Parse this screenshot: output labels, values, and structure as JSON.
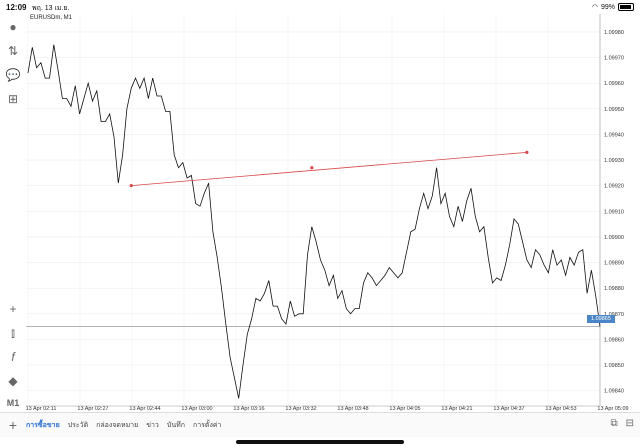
{
  "status": {
    "time": "12:09",
    "date": "พฤ. 13 เม.ย.",
    "battery": "99%"
  },
  "chart": {
    "symbol": "EURUSDm, M1",
    "current_price_label": "1.09865"
  },
  "toolbar": {
    "icons": [
      "account-icon",
      "trade-icon",
      "chat-icon",
      "new-document-icon"
    ],
    "lower_icons": [
      "crosshair-icon",
      "indicators-icon",
      "function-icon",
      "objects-icon"
    ],
    "timeframe": "M1"
  },
  "bottom": {
    "tabs": [
      "การซื้อขาย",
      "ประวัติ",
      "กล่องจดหมาย",
      "ข่าว",
      "บันทึก",
      "การตั้งค่า"
    ],
    "active_tab": 0
  },
  "chart_data": {
    "type": "line",
    "title": "EURUSDm, M1",
    "x_tick_labels": [
      "13 Apr 02:11",
      "13 Apr 02:27",
      "13 Apr 02:44",
      "13 Apr 03:00",
      "13 Apr 03:16",
      "13 Apr 03:32",
      "13 Apr 03:48",
      "13 Apr 04:05",
      "13 Apr 04:21",
      "13 Apr 04:37",
      "13 Apr 04:53",
      "13 Apr 05:09"
    ],
    "y_tick_labels": [
      "1.09980",
      "1.09970",
      "1.09960",
      "1.09950",
      "1.09940",
      "1.09930",
      "1.09920",
      "1.09910",
      "1.09900",
      "1.09890",
      "1.09880",
      "1.09870",
      "1.09860",
      "1.09850",
      "1.09840"
    ],
    "ylim": [
      1.09834,
      1.09987
    ],
    "series": [
      {
        "values": [
          1.09964,
          1.09974,
          1.09966,
          1.09968,
          1.09962,
          1.09962,
          1.09975,
          1.09965,
          1.09954,
          1.09954,
          1.09951,
          1.09959,
          1.09948,
          1.09954,
          1.0996,
          1.09953,
          1.09957,
          1.09945,
          1.09945,
          1.09948,
          1.09939,
          1.09921,
          1.09932,
          1.0995,
          1.09958,
          1.09962,
          1.09958,
          1.09962,
          1.09954,
          1.09962,
          1.09955,
          1.09955,
          1.09949,
          1.09949,
          1.09932,
          1.09927,
          1.09929,
          1.09923,
          1.09924,
          1.09913,
          1.09912,
          1.09917,
          1.09921,
          1.09902,
          1.09892,
          1.0988,
          1.09866,
          1.09853,
          1.09845,
          1.09837,
          1.0985,
          1.09862,
          1.09868,
          1.09876,
          1.09875,
          1.09878,
          1.09883,
          1.09873,
          1.09873,
          1.09868,
          1.09866,
          1.09875,
          1.09869,
          1.0987,
          1.0987,
          1.09893,
          1.09904,
          1.09898,
          1.09891,
          1.09887,
          1.09881,
          1.09885,
          1.09876,
          1.09879,
          1.09872,
          1.0987,
          1.09872,
          1.09872,
          1.09882,
          1.09886,
          1.09884,
          1.09881,
          1.09883,
          1.09885,
          1.09888,
          1.09886,
          1.09884,
          1.09886,
          1.09894,
          1.09902,
          1.09903,
          1.09911,
          1.09917,
          1.09911,
          1.09916,
          1.09927,
          1.09913,
          1.09917,
          1.09908,
          1.09904,
          1.09912,
          1.09906,
          1.09914,
          1.09919,
          1.09908,
          1.09902,
          1.09904,
          1.09892,
          1.09882,
          1.09884,
          1.09883,
          1.09889,
          1.09897,
          1.09907,
          1.09905,
          1.09898,
          1.09891,
          1.09888,
          1.09895,
          1.09893,
          1.09889,
          1.09886,
          1.09895,
          1.09889,
          1.09891,
          1.09885,
          1.09892,
          1.09889,
          1.09894,
          1.09895,
          1.09878,
          1.09887,
          1.09877,
          1.09865
        ]
      }
    ],
    "trendline": {
      "points": [
        {
          "index": 24,
          "value": 1.0992
        },
        {
          "index": 66,
          "value": 1.09927
        },
        {
          "index": 116,
          "value": 1.09933
        }
      ],
      "color": "#d94848"
    },
    "current_price": 1.09865,
    "grid": true
  }
}
